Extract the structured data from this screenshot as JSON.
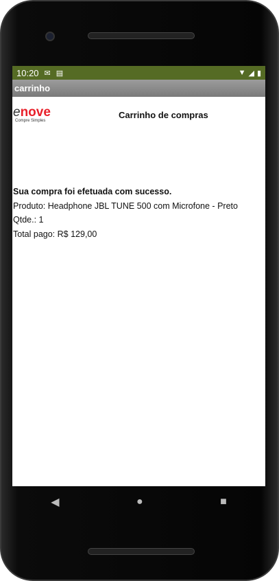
{
  "status": {
    "time": "10:20",
    "icons": [
      "gmail-icon",
      "calendar-icon"
    ],
    "right_icons": [
      "wifi-icon",
      "signal-icon",
      "battery-icon"
    ]
  },
  "appbar": {
    "title": "carrinho"
  },
  "header": {
    "logo_e": "e",
    "logo_nove": "nove",
    "logo_sub": "Compre Simples",
    "title": "Carrinho de compras"
  },
  "content": {
    "success": "Sua compra foi efetuada com sucesso.",
    "product": "Produto: Headphone JBL TUNE 500 com Microfone - Preto",
    "qty": "Qtde.: 1",
    "total": "Total pago: R$ 129,00"
  },
  "nav": {
    "back": "◀",
    "home": "●",
    "recents": "■"
  }
}
